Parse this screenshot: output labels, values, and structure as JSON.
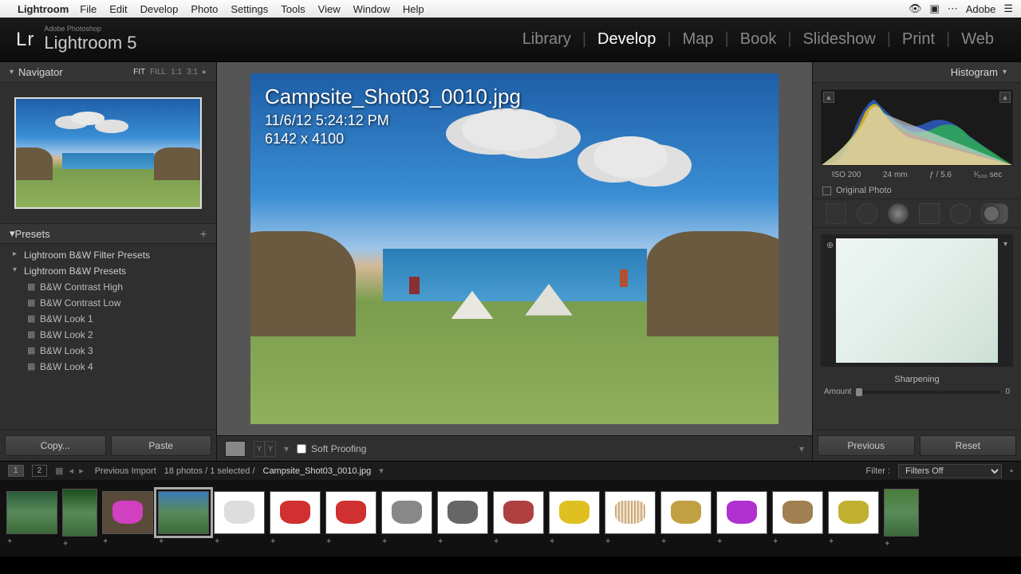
{
  "menubar": {
    "app": "Lightroom",
    "items": [
      "File",
      "Edit",
      "Develop",
      "Photo",
      "Settings",
      "Tools",
      "View",
      "Window",
      "Help"
    ],
    "right_brand": "Adobe"
  },
  "header": {
    "brand_top": "Adobe Photoshop",
    "brand_main": "Lightroom 5",
    "modules": [
      "Library",
      "Develop",
      "Map",
      "Book",
      "Slideshow",
      "Print",
      "Web"
    ],
    "active_module": "Develop"
  },
  "left": {
    "navigator": {
      "title": "Navigator",
      "zoom_opts": [
        "FIT",
        "FILL",
        "1:1",
        "3:1"
      ],
      "active_zoom": "FIT"
    },
    "presets": {
      "title": "Presets",
      "folders": [
        {
          "name": "Lightroom B&W Filter Presets",
          "open": false,
          "items": []
        },
        {
          "name": "Lightroom B&W Presets",
          "open": true,
          "items": [
            "B&W Contrast High",
            "B&W Contrast Low",
            "B&W Look 1",
            "B&W Look 2",
            "B&W Look 3",
            "B&W Look 4"
          ]
        }
      ]
    },
    "buttons": {
      "copy": "Copy...",
      "paste": "Paste"
    }
  },
  "center": {
    "filename": "Campsite_Shot03_0010.jpg",
    "datetime": "11/6/12 5:24:12 PM",
    "dimensions": "6142 x 4100",
    "soft_proofing": "Soft Proofing"
  },
  "right": {
    "histogram": {
      "title": "Histogram",
      "iso": "ISO 200",
      "focal": "24 mm",
      "aperture": "ƒ / 5.6",
      "shutter": "¹⁄₅₀₀ sec"
    },
    "original_photo": "Original Photo",
    "sharpening": {
      "label": "Sharpening",
      "amount_label": "Amount",
      "amount_value": "0"
    },
    "buttons": {
      "previous": "Previous",
      "reset": "Reset"
    }
  },
  "filmstrip_bar": {
    "monitor1": "1",
    "monitor2": "2",
    "source": "Previous Import",
    "count": "18 photos / 1 selected /",
    "filename": "Campsite_Shot03_0010.jpg",
    "filter_label": "Filter :",
    "filter_value": "Filters Off"
  },
  "filmstrip": {
    "items": [
      {
        "type": "scene",
        "tall": false,
        "color": "#2a5d3a"
      },
      {
        "type": "scene",
        "tall": true,
        "color": "#1a4d1a"
      },
      {
        "type": "obj",
        "tall": false,
        "color": "#d040c0",
        "bg": "#5a4a3a"
      },
      {
        "type": "scene",
        "tall": false,
        "color": "#3a7ab8",
        "selected": true
      },
      {
        "type": "obj",
        "tall": false,
        "color": "#ddd",
        "bg": "#fff"
      },
      {
        "type": "obj",
        "tall": false,
        "color": "#d03030",
        "bg": "#fff"
      },
      {
        "type": "obj",
        "tall": false,
        "color": "#d03030",
        "bg": "#fff"
      },
      {
        "type": "obj",
        "tall": false,
        "color": "#888",
        "bg": "#fff"
      },
      {
        "type": "obj",
        "tall": false,
        "color": "#666",
        "bg": "#fff"
      },
      {
        "type": "obj",
        "tall": false,
        "color": "#b04040",
        "bg": "#fff"
      },
      {
        "type": "obj",
        "tall": false,
        "color": "#e0c020",
        "bg": "#fff"
      },
      {
        "type": "obj",
        "tall": false,
        "color": "#c09050",
        "bg": "#fff",
        "stripes": true
      },
      {
        "type": "obj",
        "tall": false,
        "color": "#c0a040",
        "bg": "#fff"
      },
      {
        "type": "obj",
        "tall": false,
        "color": "#b030d0",
        "bg": "#fff"
      },
      {
        "type": "obj",
        "tall": false,
        "color": "#a08050",
        "bg": "#fff"
      },
      {
        "type": "obj",
        "tall": false,
        "color": "#c0b030",
        "bg": "#fff"
      },
      {
        "type": "scene",
        "tall": true,
        "color": "#4a7d3a"
      }
    ]
  }
}
